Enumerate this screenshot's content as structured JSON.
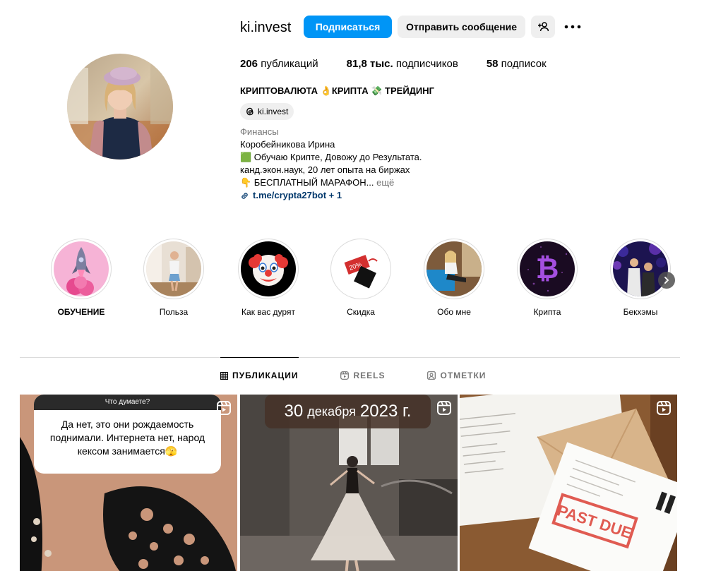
{
  "profile": {
    "username": "ki.invest",
    "follow_label": "Подписаться",
    "message_label": "Отправить сообщение"
  },
  "stats": {
    "posts_value": "206",
    "posts_label": "публикаций",
    "followers_value": "81,8 тыс.",
    "followers_label": "подписчиков",
    "following_value": "58",
    "following_label": "подписок"
  },
  "bio": {
    "title": "КРИПТОВАЛЮТА 👌КРИПТА 💸 ТРЕЙДИНГ",
    "threads_handle": "ki.invest",
    "category": "Финансы",
    "name": "Коробейникова Ирина",
    "line1": "🟩 Обучаю Крипте, Довожу до Результата.",
    "line2": "канд.экон.наук, 20 лет опыта на биржах",
    "line3": "👇 БЕСПЛАТНЫЙ МАРАФОН...",
    "more_label": "ещё",
    "link_text": "t.me/crypta27bot",
    "link_extra": "+ 1"
  },
  "highlights": [
    {
      "label": "ОБУЧЕНИЕ",
      "icon": "rocket"
    },
    {
      "label": "Польза",
      "icon": "woman-yoga"
    },
    {
      "label": "Как вас дурят",
      "icon": "clown-face"
    },
    {
      "label": "Скидка",
      "icon": "sale-tags"
    },
    {
      "label": "Обо мне",
      "icon": "woman-sofa"
    },
    {
      "label": "Крипта",
      "icon": "bitcoin"
    },
    {
      "label": "Бекхэмы",
      "icon": "party-couple"
    }
  ],
  "tabs": {
    "posts": "ПУБЛИКАЦИИ",
    "reels": "REELS",
    "tagged": "ОТМЕТКИ"
  },
  "posts": {
    "p1_question_head": "Что думаете?",
    "p1_question_body": "Да нет, это они рождаемость поднимали. Интернета нет, народ кексом занимается🫣",
    "p2_date_day": "30",
    "p2_date_month": "декабря",
    "p2_date_year": "2023 г.",
    "p3_stamp": "PAST DUE"
  },
  "colors": {
    "accent": "#0095f6",
    "secondary_button": "#efefef",
    "link": "#00376b",
    "muted": "#737373"
  }
}
